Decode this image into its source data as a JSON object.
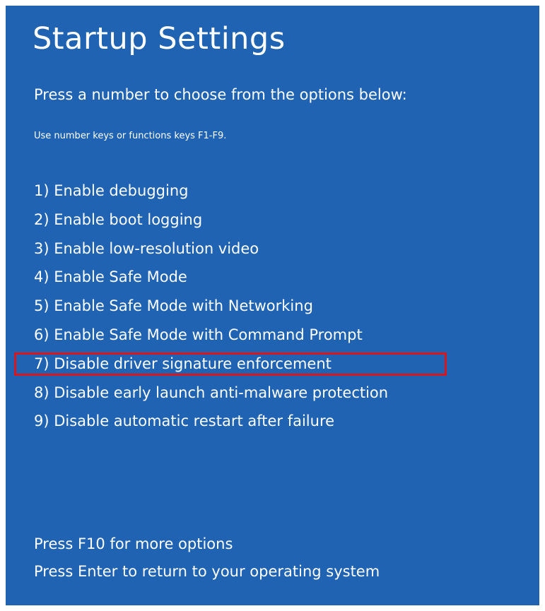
{
  "screen": {
    "title": "Startup Settings",
    "subtitle": "Press a number to choose from the options below:",
    "hint": "Use number keys or functions keys F1-F9.",
    "options": [
      "1) Enable debugging",
      "2) Enable boot logging",
      "3) Enable low-resolution video",
      "4) Enable Safe Mode",
      "5) Enable Safe Mode with Networking",
      "6) Enable Safe Mode with Command Prompt",
      "7) Disable driver signature enforcement",
      "8) Disable early launch anti-malware protection",
      "9) Disable automatic restart after failure"
    ],
    "highlighted_option_index": 6,
    "footer": [
      "Press F10 for more options",
      "Press Enter to return to your operating system"
    ]
  },
  "colors": {
    "background": "#1f63b2",
    "text": "#ffffff",
    "highlight_border": "#d9161c"
  }
}
